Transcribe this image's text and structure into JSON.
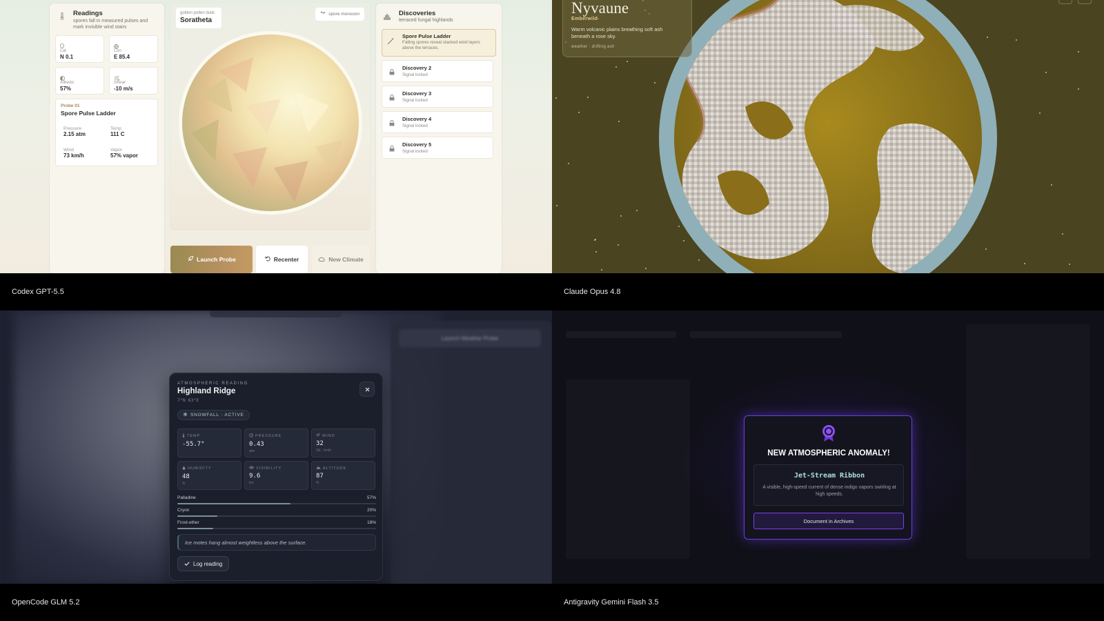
{
  "q1": {
    "caption": "Codex GPT-5.5",
    "readings": {
      "title": "Readings",
      "subtitle": "spores fall in measured pulses and mark invisible wind stairs",
      "stats": [
        {
          "label": "Lat",
          "value": "N 0.1"
        },
        {
          "label": "Lon",
          "value": "E 85.4"
        },
        {
          "label": "Albedo",
          "value": "57%"
        },
        {
          "label": "Shear",
          "value": "-10 m/s"
        }
      ],
      "probe": {
        "tag": "Probe 01",
        "name": "Spore Pulse Ladder",
        "items": [
          {
            "label": "Pressure",
            "value": "2.15 atm"
          },
          {
            "label": "Temp",
            "value": "111 C"
          },
          {
            "label": "Wind",
            "value": "73 km/h"
          },
          {
            "label": "Vapor",
            "value": "57% vapor"
          }
        ]
      }
    },
    "planet": {
      "sublabel": "golden pollen dusk",
      "name": "Soratheta",
      "weather": "spore monsoon"
    },
    "buttons": {
      "launch": "Launch Probe",
      "recenter": "Recenter",
      "new_climate": "New Climate"
    },
    "discoveries": {
      "title": "Discoveries",
      "subtitle": "terraced fungal highlands",
      "featured": {
        "name": "Spore Pulse Ladder",
        "desc": "Falling spores reveal stacked wind layers above the terraces."
      },
      "locked": [
        {
          "name": "Discovery 2",
          "status": "Signal locked"
        },
        {
          "name": "Discovery 3",
          "status": "Signal locked"
        },
        {
          "name": "Discovery 4",
          "status": "Signal locked"
        },
        {
          "name": "Discovery 5",
          "status": "Signal locked"
        }
      ]
    }
  },
  "q2": {
    "caption": "Claude Opus 4.8",
    "planet_name": "Nyvaune",
    "biome": "Emberwild",
    "desc": "Warm volcanic plains breathing soft ash beneath a rose sky.",
    "meta": "weather · drifting ash"
  },
  "q3": {
    "caption": "OpenCode GLM 5.2",
    "eyebrow": "ATMOSPHERIC READING",
    "title": "Highland Ridge",
    "coords": "7°N 63°E",
    "status": "SNOWFALL · ACTIVE",
    "stats": [
      {
        "label": "TEMP",
        "value": "-55.7°",
        "unit": ""
      },
      {
        "label": "PRESSURE",
        "value": "0.43",
        "unit": "atm"
      },
      {
        "label": "WIND",
        "value": "32",
        "unit": "SE · km/h"
      },
      {
        "label": "HUMIDITY",
        "value": "48",
        "unit": "%"
      },
      {
        "label": "VISIBILITY",
        "value": "9.6",
        "unit": "km"
      },
      {
        "label": "ALTITUDE",
        "value": "87",
        "unit": "%"
      }
    ],
    "gases": [
      {
        "name": "Palladine",
        "pct": "57%",
        "frac": 0.57
      },
      {
        "name": "Cryon",
        "pct": "20%",
        "frac": 0.2
      },
      {
        "name": "Frost-ether",
        "pct": "18%",
        "frac": 0.18
      }
    ],
    "note": "Ice motes hang almost weightless above the surface.",
    "log_button": "Log reading",
    "bg_button": "Launch Weather Probe"
  },
  "q4": {
    "caption": "Antigravity Gemini Flash 3.5",
    "modal_title": "NEW ATMOSPHERIC ANOMALY!",
    "anomaly_name": "Jet-Stream Ribbon",
    "anomaly_desc": "A visible, high-speed current of dense indigo vapors swirling at high speeds.",
    "button": "Document in Archives"
  },
  "colors": {
    "accent_gold": "#b99a4f",
    "q3_accent": "#7a9098",
    "q4_purple": "#7b3ff2"
  }
}
